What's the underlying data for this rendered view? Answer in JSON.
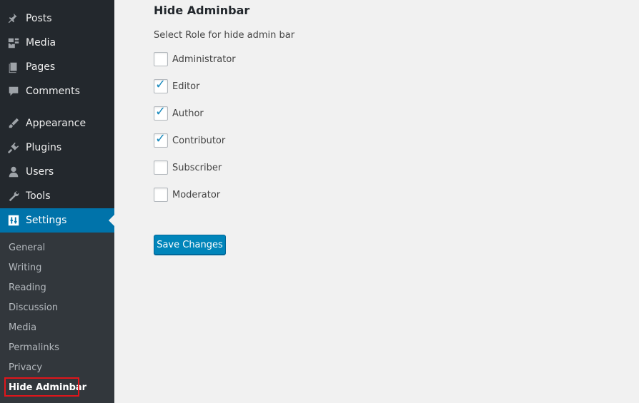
{
  "sidebar": {
    "items": [
      {
        "label": "Posts",
        "icon": "pin-icon"
      },
      {
        "label": "Media",
        "icon": "media-icon"
      },
      {
        "label": "Pages",
        "icon": "pages-icon"
      },
      {
        "label": "Comments",
        "icon": "comment-icon"
      },
      {
        "label": "Appearance",
        "icon": "brush-icon"
      },
      {
        "label": "Plugins",
        "icon": "plugin-icon"
      },
      {
        "label": "Users",
        "icon": "user-icon"
      },
      {
        "label": "Tools",
        "icon": "wrench-icon"
      },
      {
        "label": "Settings",
        "icon": "settings-icon"
      }
    ],
    "submenu": [
      "General",
      "Writing",
      "Reading",
      "Discussion",
      "Media",
      "Permalinks",
      "Privacy",
      "Hide Adminbar"
    ]
  },
  "main": {
    "title": "Hide Adminbar",
    "description": "Select Role for hide admin bar",
    "roles": [
      {
        "label": "Administrator",
        "checked": false
      },
      {
        "label": "Editor",
        "checked": true
      },
      {
        "label": "Author",
        "checked": true
      },
      {
        "label": "Contributor",
        "checked": true
      },
      {
        "label": "Subscriber",
        "checked": false
      },
      {
        "label": "Moderator",
        "checked": false
      }
    ],
    "save_label": "Save Changes"
  },
  "colors": {
    "accent": "#0073aa",
    "check": "#1e8cbe",
    "highlight": "#e0151b"
  }
}
